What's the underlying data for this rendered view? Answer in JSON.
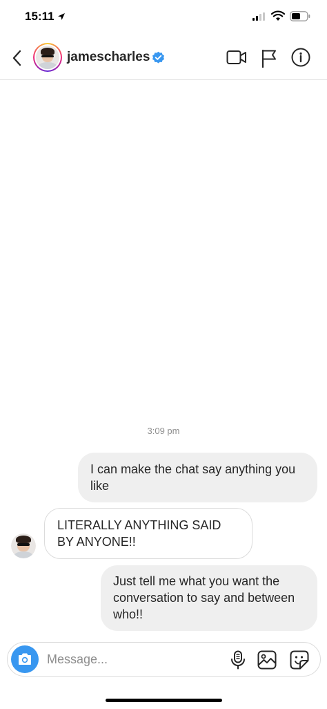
{
  "status_bar": {
    "time": "15:11",
    "icons": [
      "location-arrow-icon",
      "signal-icon",
      "wifi-icon",
      "battery-icon"
    ]
  },
  "header": {
    "username": "jamescharles",
    "verified": true,
    "icons": [
      "back-icon",
      "verified-badge-icon",
      "video-call-icon",
      "flag-icon",
      "info-icon"
    ]
  },
  "thread": {
    "timestamp": "3:09 pm",
    "messages": [
      {
        "direction": "outgoing",
        "text": "I can make the chat say anything you like"
      },
      {
        "direction": "incoming",
        "text": "LITERALLY ANYTHING SAID BY ANYONE!!"
      },
      {
        "direction": "outgoing",
        "text": "Just tell me what you want the conversation to say and between who!!"
      }
    ]
  },
  "composer": {
    "placeholder": "Message...",
    "value": "",
    "icons": [
      "camera-icon",
      "microphone-icon",
      "gallery-icon",
      "sticker-icon"
    ]
  },
  "colors": {
    "accent_blue": "#3897f0",
    "verified_blue": "#3897f0",
    "outgoing_bubble": "#efefef",
    "incoming_border": "#dbdbdb",
    "text": "#262626",
    "muted_text": "#8e8e8e"
  }
}
